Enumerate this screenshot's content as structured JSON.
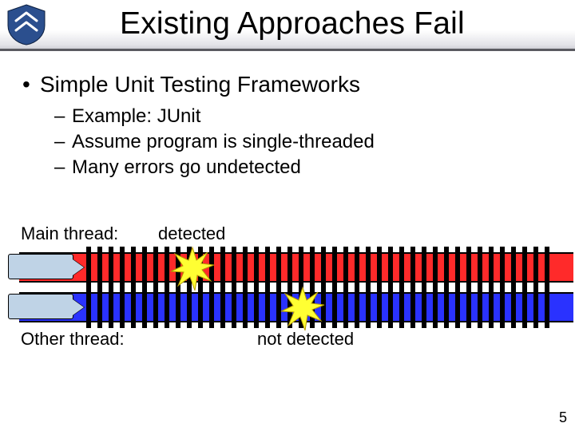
{
  "title": "Existing Approaches Fail",
  "bullets": {
    "l1": "Simple Unit Testing Frameworks",
    "l2": [
      "Example: JUnit",
      "Assume program is single-threaded",
      "Many errors go undetected"
    ]
  },
  "diagram": {
    "main_label": "Main thread:",
    "other_label": "Other thread:",
    "detected_label": "detected",
    "not_detected_label": "not detected"
  },
  "page_number": "5",
  "colors": {
    "main_track": "#ff2a2a",
    "other_track": "#2a32ff",
    "burst_fill": "#ffff33"
  }
}
